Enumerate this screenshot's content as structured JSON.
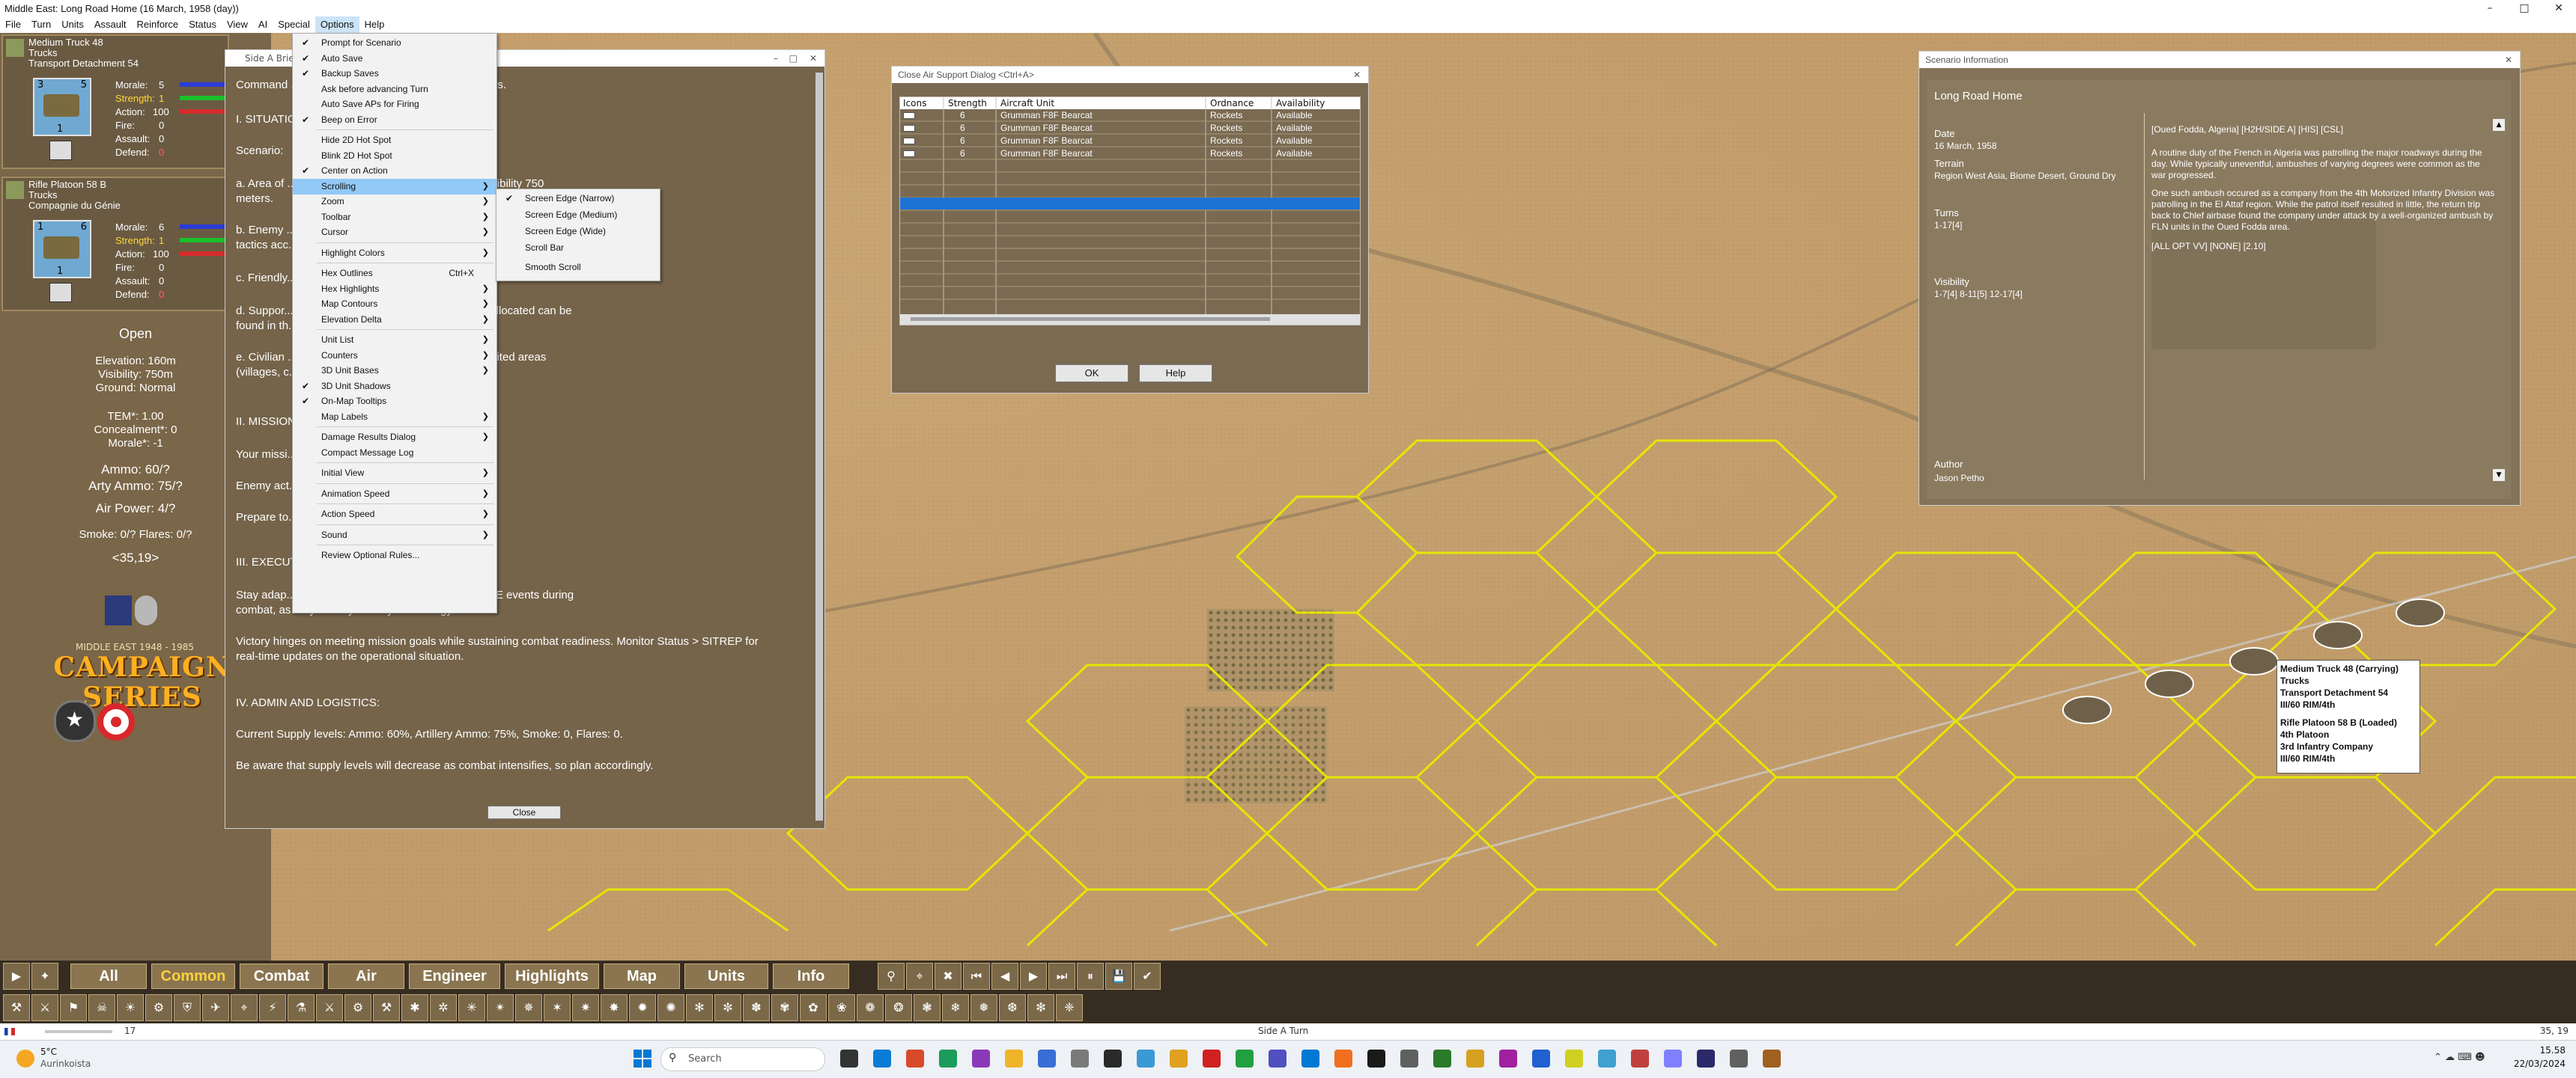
{
  "window": {
    "title": "Middle East: Long Road Home (16 March, 1958 (day))"
  },
  "menubar": [
    "File",
    "Turn",
    "Units",
    "Assault",
    "Reinforce",
    "Status",
    "View",
    "AI",
    "Special",
    "Options",
    "Help"
  ],
  "units": [
    {
      "name": "Medium Truck 48",
      "type": "Trucks",
      "parent": "Transport Detachment 54",
      "counter_top": "3",
      "counter_top2": "5",
      "counter_bottom": "1",
      "morale": "5",
      "strength": "1",
      "action": "100",
      "fire": "0",
      "assault": "0",
      "defend": "0",
      "labels": {
        "morale": "Morale:",
        "strength": "Strength:",
        "action": "Action:",
        "fire": "Fire:",
        "assault": "Assault:",
        "defend": "Defend:"
      }
    },
    {
      "name": "Rifle Platoon 58 B",
      "type": "Trucks",
      "parent": "Compagnie du Génie",
      "counter_top": "1",
      "counter_top2": "6",
      "counter_bottom": "1",
      "morale": "6",
      "strength": "1",
      "action": "100",
      "fire": "0",
      "assault": "0",
      "defend": "0",
      "labels": {
        "morale": "Morale:",
        "strength": "Strength:",
        "action": "Action:",
        "fire": "Fire:",
        "assault": "Assault:",
        "defend": "Defend:"
      }
    }
  ],
  "hexinfo": {
    "terrain": "Open",
    "elevation": "Elevation: 160m",
    "visibility": "Visibility: 750m",
    "ground": "Ground: Normal",
    "tem": "TEM*: 1.00",
    "concealment": "Concealment*: 0",
    "morale": "Morale*: -1",
    "ammo": "Ammo: 60/?",
    "arty": "Arty Ammo: 75/?",
    "air": "Air Power: 4/?",
    "smoke": "Smoke: 0/? Flares: 0/?",
    "coords": "<35,19>"
  },
  "logo": {
    "small": "MIDDLE EAST 1948 - 1985",
    "big": "CAMPAIGN SERIES"
  },
  "briefing": {
    "title": "Side A Briefing",
    "lines": [
      "Command ... provided below. Proceed with exactness.",
      "I. SITUATION",
      "Scenario:",
      "a. Area of ... n: Desert, dry ground. Weather: day, visibility 750",
      "meters.",
      "b. Enemy ... ed as critical. Adjust your",
      "tactics acc...",
      "c. Friendly...",
      "d. Suppor... of Close Air Support. Current missions allocated can be",
      "found in th...",
      "e. Civilian ... nts for indirect fire or airstrikes on inhabited areas",
      "(villages, c... sence.",
      "II. MISSION",
      "Your missi... rom turn 1 to turn 17.",
      "Enemy act... sh, from turn 1 to turn 17.",
      "Prepare to...",
      "III. EXECUT...",
      "Stay adap... d dynamics. Pay close attention to CSEE events during",
      "combat, as they directly affect your strategy.",
      "Victory hinges on meeting mission goals while sustaining combat readiness. Monitor Status > SITREP for",
      "real-time updates on the operational situation.",
      "IV. ADMIN AND LOGISTICS:",
      "Current Supply levels: Ammo: 60%, Artillery Ammo: 75%, Smoke: 0, Flares: 0.",
      "Be aware that supply levels will decrease as combat intensifies, so plan accordingly."
    ],
    "close": "Close"
  },
  "optionsmenu": [
    {
      "label": "Prompt for Scenario",
      "check": true
    },
    {
      "label": "Auto Save",
      "check": true
    },
    {
      "label": "Backup Saves",
      "check": true
    },
    {
      "label": "Ask before advancing Turn",
      "check": false
    },
    {
      "label": "Auto Save APs for Firing",
      "check": false
    },
    {
      "label": "Beep on Error",
      "check": true
    },
    {
      "sep": true
    },
    {
      "label": "Hide 2D Hot Spot",
      "check": false
    },
    {
      "label": "Blink 2D Hot Spot",
      "check": false
    },
    {
      "label": "Center on Action",
      "check": true
    },
    {
      "label": "Scrolling",
      "check": false,
      "arrow": true,
      "hl": true
    },
    {
      "label": "Zoom",
      "check": false,
      "arrow": true
    },
    {
      "label": "Toolbar",
      "check": false,
      "arrow": true
    },
    {
      "label": "Cursor",
      "check": false,
      "arrow": true
    },
    {
      "sep": true
    },
    {
      "label": "Highlight Colors",
      "check": false,
      "arrow": true
    },
    {
      "sep": true
    },
    {
      "label": "Hex Outlines",
      "check": false,
      "shortcut": "Ctrl+X"
    },
    {
      "label": "Hex Highlights",
      "check": false,
      "arrow": true
    },
    {
      "label": "Map Contours",
      "check": false,
      "arrow": true
    },
    {
      "label": "Elevation Delta",
      "check": false,
      "arrow": true
    },
    {
      "sep": true
    },
    {
      "label": "Unit List",
      "check": false,
      "arrow": true
    },
    {
      "label": "Counters",
      "check": false,
      "arrow": true
    },
    {
      "label": "3D Unit Bases",
      "check": false,
      "arrow": true
    },
    {
      "label": "3D Unit Shadows",
      "check": true
    },
    {
      "label": "On-Map Tooltips",
      "check": true
    },
    {
      "label": "Map Labels",
      "check": false,
      "arrow": true
    },
    {
      "sep": true
    },
    {
      "label": "Damage Results Dialog",
      "check": false,
      "arrow": true
    },
    {
      "label": "Compact Message Log",
      "check": false
    },
    {
      "sep": true
    },
    {
      "label": "Initial View",
      "check": false,
      "arrow": true
    },
    {
      "sep": true
    },
    {
      "label": "Animation Speed",
      "check": false,
      "arrow": true
    },
    {
      "sep": true
    },
    {
      "label": "Action Speed",
      "check": false,
      "arrow": true
    },
    {
      "sep": true
    },
    {
      "label": "Sound",
      "check": false,
      "arrow": true
    },
    {
      "sep": true
    },
    {
      "label": "Review Optional Rules...",
      "check": false
    }
  ],
  "scrollsub": [
    {
      "label": "Screen Edge (Narrow)",
      "check": true
    },
    {
      "label": "Screen Edge (Medium)",
      "check": false
    },
    {
      "label": "Screen Edge (Wide)",
      "check": false
    },
    {
      "label": "Scroll Bar",
      "check": false
    },
    {
      "label": "Smooth Scroll",
      "check": false
    }
  ],
  "cas": {
    "title": "Close Air Support Dialog <Ctrl+A>",
    "headers": [
      "Icons",
      "Strength",
      "Aircraft Unit",
      "Ordnance",
      "Availability"
    ],
    "rows": [
      [
        "",
        "6",
        "Grumman F8F Bearcat",
        "Rockets",
        "Available"
      ],
      [
        "",
        "6",
        "Grumman F8F Bearcat",
        "Rockets",
        "Available"
      ],
      [
        "",
        "6",
        "Grumman F8F Bearcat",
        "Rockets",
        "Available"
      ],
      [
        "",
        "6",
        "Grumman F8F Bearcat",
        "Rockets",
        "Available"
      ]
    ],
    "ok": "OK",
    "help": "Help"
  },
  "scenario": {
    "wtitle": "Scenario Information",
    "title": "Long Road Home",
    "date_label": "Date",
    "date": "16 March, 1958",
    "terrain_label": "Terrain",
    "terrain": "Region West Asia, Biome Desert, Ground Dry",
    "turns_label": "Turns",
    "turns": "1-17[4]",
    "vis_label": "Visibility",
    "vis": "1-7[4] 8-11[5] 12-17[4]",
    "author_label": "Author",
    "author": "Jason Petho",
    "tag": "[Oued Fodda, Algeria] [H2H/SIDE A] [HIS] [CSL]",
    "p1": "A routine duty of the French in Algeria was patrolling the major roadways during the day. While typically uneventful, ambushes of varying degrees were common as the war progressed.",
    "p2": "One such ambush occured as a company from the 4th Motorized Infantry Division was patrolling in the El Attaf region. While the patrol itself resulted in little, the return trip back to Chlef airbase found the company under attack by a well-organized ambush by FLN units in the Oued Fodda area.",
    "p3": "[ALL OPT VV] [NONE] [2.10]"
  },
  "tooltip": [
    "Medium Truck 48 (Carrying)",
    "Trucks",
    "Transport Detachment 54",
    "III/60 RIM/4th",
    "",
    "Rifle Platoon 58 B (Loaded)",
    "4th Platoon",
    "3rd Infantry Company",
    "III/60 RIM/4th"
  ],
  "tabs": [
    "All",
    "Common",
    "Combat",
    "Air",
    "Engineer",
    "Highlights",
    "Map",
    "Units",
    "Info"
  ],
  "selectedTab": "Common",
  "status": {
    "left": "17",
    "mid": "Side A Turn",
    "right": "35, 19"
  },
  "taskbar": {
    "temp": "5°C",
    "weather": "Aurinkoista",
    "search": "Search",
    "time": "15.58",
    "date": "22/03/2024"
  },
  "colors": {
    "map": "#c4a06e",
    "panel": "#75644a",
    "hex": "#e6e600",
    "accent": "#1e73d4"
  }
}
